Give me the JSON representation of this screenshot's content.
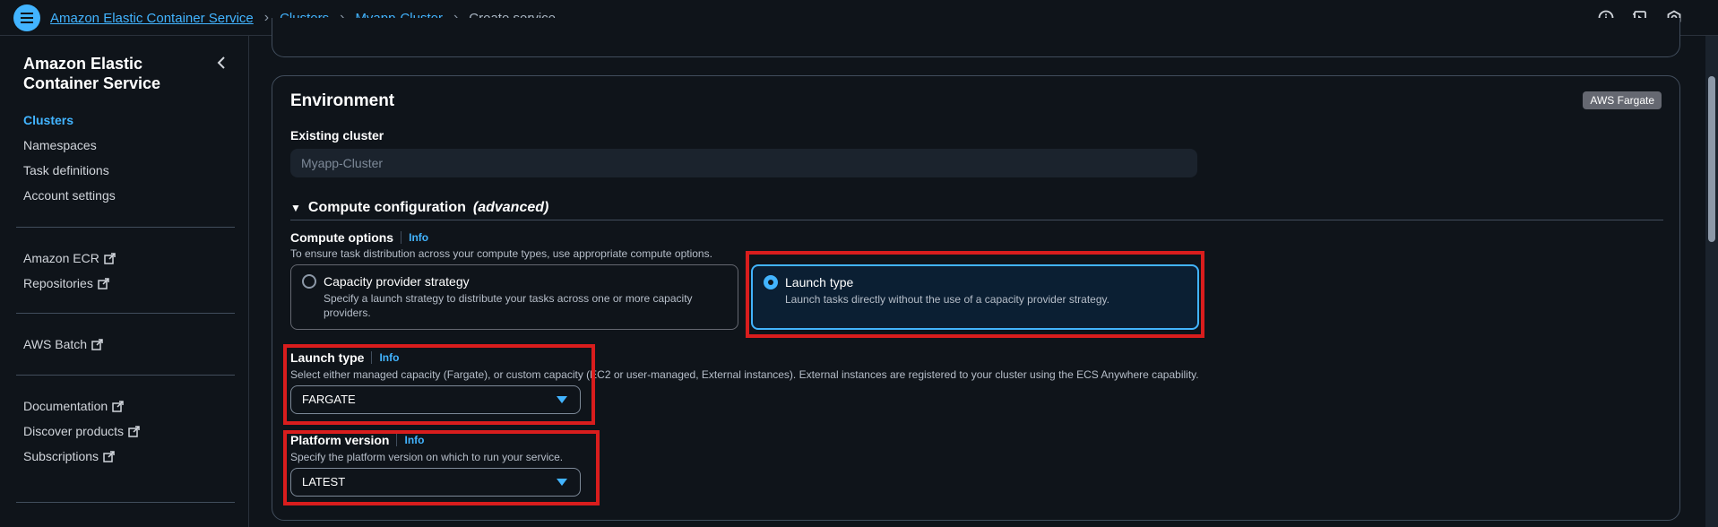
{
  "breadcrumb": {
    "items": [
      "Amazon Elastic Container Service",
      "Clusters",
      "Myapp-Cluster"
    ],
    "current": "Create service"
  },
  "sidebar": {
    "title": "Amazon Elastic Container Service",
    "nav": [
      "Clusters",
      "Namespaces",
      "Task definitions",
      "Account settings"
    ],
    "group2": [
      "Amazon ECR",
      "Repositories"
    ],
    "group3": [
      "AWS Batch"
    ],
    "group4": [
      "Documentation",
      "Discover products",
      "Subscriptions"
    ]
  },
  "environment": {
    "title": "Environment",
    "badge": "AWS Fargate",
    "existing_cluster_label": "Existing cluster",
    "existing_cluster_value": "Myapp-Cluster",
    "compute_section_title": "Compute configuration",
    "compute_section_suffix": "(advanced)",
    "compute_options_label": "Compute options",
    "info_label": "Info",
    "compute_options_desc": "To ensure task distribution across your compute types, use appropriate compute options.",
    "tiles": [
      {
        "title": "Capacity provider strategy",
        "desc": "Specify a launch strategy to distribute your tasks across one or more capacity providers.",
        "selected": false
      },
      {
        "title": "Launch type",
        "desc": "Launch tasks directly without the use of a capacity provider strategy.",
        "selected": true
      }
    ],
    "launch_type_label": "Launch type",
    "launch_type_desc": "Select either managed capacity (Fargate), or custom capacity (EC2 or user-managed, External instances). External instances are registered to your cluster using the ECS Anywhere capability.",
    "launch_type_value": "FARGATE",
    "platform_version_label": "Platform version",
    "platform_version_desc": "Specify the platform version on which to run your service.",
    "platform_version_value": "LATEST"
  },
  "colors": {
    "accent": "#42b4ff",
    "highlight": "#d91d1d",
    "background": "#0f141a"
  }
}
